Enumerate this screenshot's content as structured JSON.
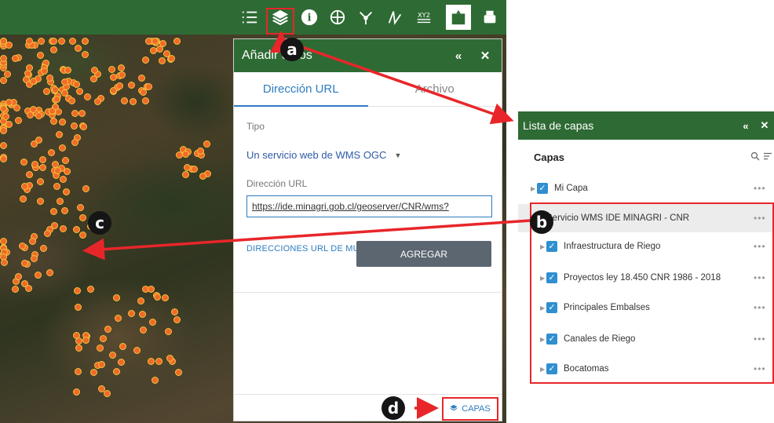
{
  "colors": {
    "header": "#2e6b34",
    "accent": "#2e7cbf",
    "highlight": "#e8262a",
    "checkbox": "#2f8fd0",
    "map_point": "#f06a2a"
  },
  "toolbar": {
    "tools": [
      {
        "name": "list-icon",
        "active": false
      },
      {
        "name": "layers-icon",
        "active": false
      },
      {
        "name": "info-icon",
        "active": false
      },
      {
        "name": "basemap-icon",
        "active": false
      },
      {
        "name": "share-icon",
        "active": false
      },
      {
        "name": "measure-icon",
        "active": false
      },
      {
        "name": "xy-icon",
        "label": "XY2",
        "active": false
      },
      {
        "name": "add-data-icon",
        "active": true
      },
      {
        "name": "print-icon",
        "active": false
      }
    ]
  },
  "add_data": {
    "title": "Añadir datos",
    "collapse": "«",
    "close": "✕",
    "tabs": [
      "Dirección URL",
      "Archivo"
    ],
    "type_label": "Tipo",
    "type_value": "Un servicio web de WMS OGC",
    "url_label": "Dirección URL",
    "url_value": "https://ide.minagri.gob.cl/geoserver/CNR/wms?",
    "sample_link": "DIRECCIONES URL DE MUESTRA",
    "add_button": "AGREGAR",
    "footer_button": "CAPAS"
  },
  "layer_list": {
    "title": "Lista de capas",
    "collapse": "«",
    "close": "✕",
    "subtitle": "Capas",
    "more": "•••",
    "layers": [
      {
        "label": "Mi Capa",
        "level": 0
      },
      {
        "label": "Servicio WMS IDE MINAGRI - CNR",
        "level": 0,
        "highlighted": true
      },
      {
        "label": "Infraestructura de Riego",
        "level": 1
      },
      {
        "label": "Proyectos ley 18.450 CNR 1986 - 2018",
        "level": 1
      },
      {
        "label": "Principales Embalses",
        "level": 1
      },
      {
        "label": "Canales de Riego",
        "level": 1
      },
      {
        "label": "Bocatomas",
        "level": 1
      }
    ]
  },
  "callouts": {
    "a": "a",
    "b": "b",
    "c": "c",
    "d": "d"
  }
}
